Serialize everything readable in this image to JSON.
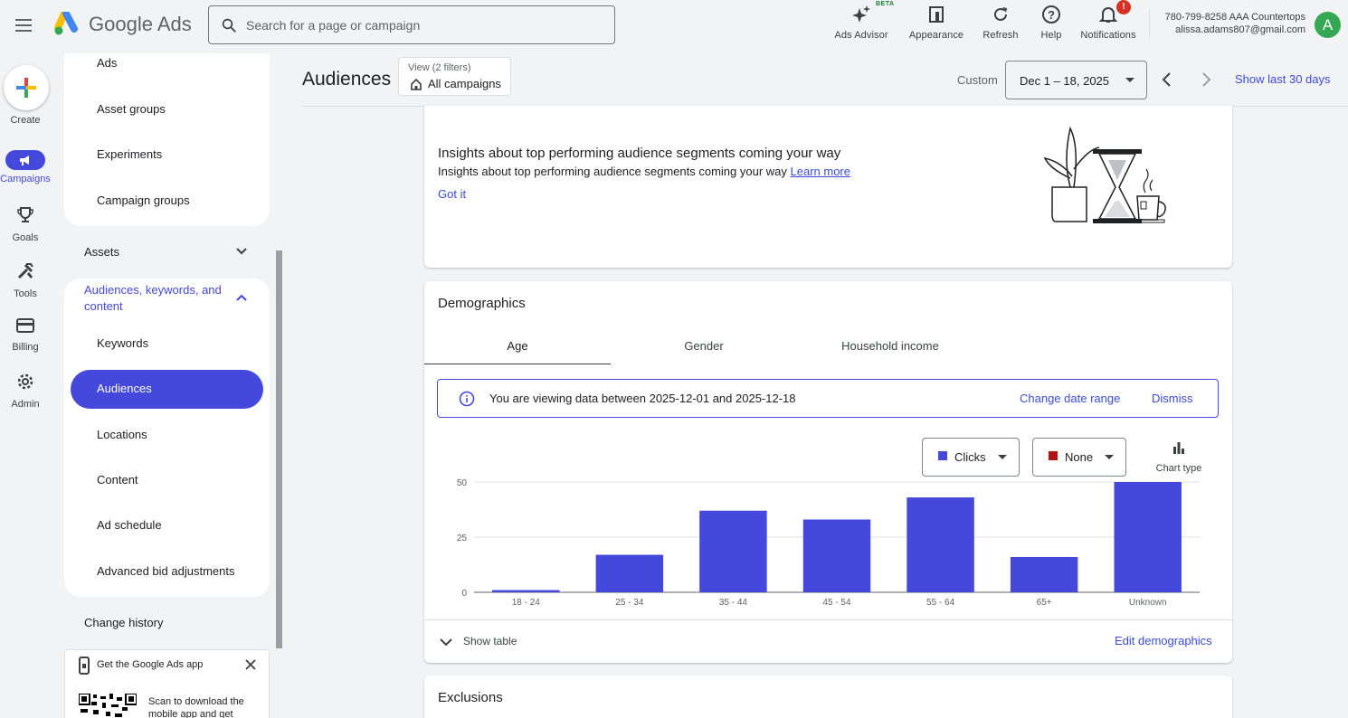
{
  "app": {
    "logo_text": "Google Ads"
  },
  "search": {
    "placeholder": "Search for a page or campaign"
  },
  "toolbar": {
    "ads_advisor": "Ads Advisor",
    "beta": "BETA",
    "appearance": "Appearance",
    "refresh": "Refresh",
    "help": "Help",
    "notifications": "Notifications",
    "notifications_badge": "!"
  },
  "account": {
    "line1": "780-799-8258 AAA Countertops",
    "line2": "alissa.adams807@gmail.com",
    "avatar_letter": "A"
  },
  "rail": {
    "create": "Create",
    "campaigns": "Campaigns",
    "goals": "Goals",
    "tools": "Tools",
    "billing": "Billing",
    "admin": "Admin"
  },
  "nav": {
    "ads": "Ads",
    "asset_groups": "Asset groups",
    "experiments": "Experiments",
    "campaign_groups": "Campaign groups",
    "assets": "Assets",
    "audiences_section_line1": "Audiences, keywords, and",
    "audiences_section_line2": "content",
    "keywords": "Keywords",
    "audiences": "Audiences",
    "locations": "Locations",
    "content": "Content",
    "ad_schedule": "Ad schedule",
    "advanced_bid": "Advanced bid adjustments",
    "change_history": "Change history"
  },
  "promo": {
    "title": "Get the Google Ads app",
    "body_line1": "Scan to download the",
    "body_line2": "mobile app and get"
  },
  "header": {
    "title": "Audiences",
    "view_label": "View (2 filters)",
    "view_value": "All campaigns",
    "custom_label": "Custom",
    "date_range": "Dec 1 – 18, 2025",
    "show_last": "Show last 30 days"
  },
  "insight": {
    "title": "Insights about top performing audience segments coming your way",
    "body": "Insights about top performing audience segments coming your way",
    "learn_more": "Learn more",
    "got_it": "Got it"
  },
  "demographics": {
    "title": "Demographics",
    "tabs": [
      "Age",
      "Gender",
      "Household income"
    ],
    "active_tab": "Age",
    "banner_text": "You are viewing data between 2025-12-01 and 2025-12-18",
    "change_date_range": "Change date range",
    "dismiss": "Dismiss",
    "metric1": "Clicks",
    "metric1_color": "#4448db",
    "metric2": "None",
    "metric2_color": "#b31412",
    "chart_type": "Chart type",
    "show_table": "Show table",
    "edit_demographics": "Edit demographics"
  },
  "exclusions": {
    "title": "Exclusions"
  },
  "chart_data": {
    "type": "bar",
    "categories": [
      "18 - 24",
      "25 - 34",
      "35 - 44",
      "45 - 54",
      "55 - 64",
      "65+",
      "Unknown"
    ],
    "series": [
      {
        "name": "Clicks",
        "values": [
          1,
          17,
          37,
          33,
          43,
          16,
          50
        ]
      }
    ],
    "yticks": [
      0,
      25,
      50
    ],
    "ylim": [
      0,
      50
    ],
    "color": "#4448db",
    "grid": true
  }
}
